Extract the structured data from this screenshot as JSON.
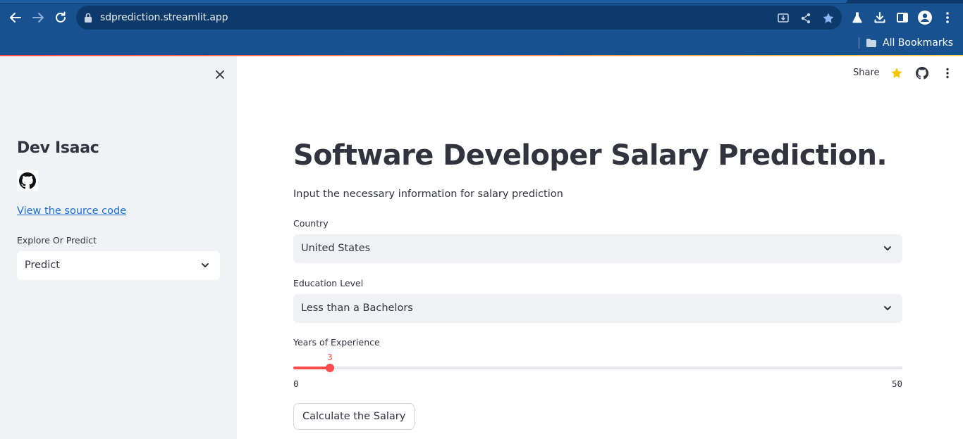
{
  "browser": {
    "url": "sdprediction.streamlit.app",
    "bookmarks_label": "All Bookmarks",
    "accent": "#17518f"
  },
  "sidebar": {
    "author": "Dev Isaac",
    "source_link": "View the source code",
    "select_label": "Explore Or Predict",
    "select_value": "Predict",
    "background": "#f0f2f6"
  },
  "header": {
    "share_label": "Share"
  },
  "main": {
    "title": "Software Developer Salary Prediction.",
    "subtitle": "Input the necessary information for salary prediction",
    "country": {
      "label": "Country",
      "value": "United States"
    },
    "education": {
      "label": "Education Level",
      "value": "Less than a Bachelors"
    },
    "experience": {
      "label": "Years of Experience",
      "value": "3",
      "min": "0",
      "max": "50",
      "value_num": 3,
      "min_num": 0,
      "max_num": 50,
      "accent": "#ff4b4b"
    },
    "calculate_button": "Calculate the Salary"
  }
}
